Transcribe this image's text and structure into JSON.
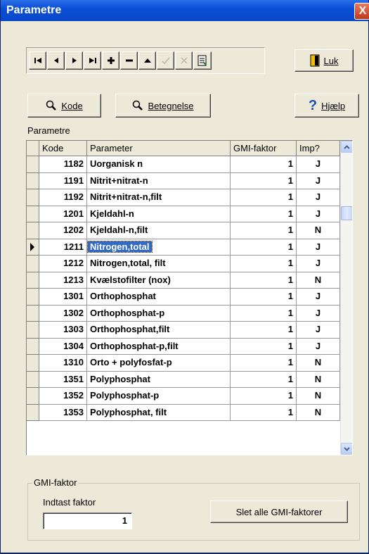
{
  "window": {
    "title": "Parametre",
    "close_glyph": "X"
  },
  "toolbar": {
    "nav_icons": [
      "first-record-icon",
      "prior-record-icon",
      "next-record-icon",
      "last-record-icon",
      "insert-record-icon",
      "delete-record-icon",
      "edit-record-icon",
      "post-record-icon",
      "cancel-record-icon",
      "refresh-record-icon"
    ],
    "luk_label": "Luk",
    "kode_label": "Kode",
    "betegnelse_label": "Betegnelse",
    "hjaelp_label": "Hjælp",
    "help_glyph": "?"
  },
  "grid": {
    "caption": "Parametre",
    "columns": [
      "Kode",
      "Parameter",
      "GMI-faktor",
      "Imp?"
    ],
    "selected_index": 5,
    "rows": [
      {
        "kode": "1182",
        "parameter": "Uorganisk n",
        "gmi": "1",
        "imp": "J"
      },
      {
        "kode": "1191",
        "parameter": "Nitrit+nitrat-n",
        "gmi": "1",
        "imp": "J"
      },
      {
        "kode": "1192",
        "parameter": "Nitrit+nitrat-n,filt",
        "gmi": "1",
        "imp": "J"
      },
      {
        "kode": "1201",
        "parameter": "Kjeldahl-n",
        "gmi": "1",
        "imp": "J"
      },
      {
        "kode": "1202",
        "parameter": "Kjeldahl-n,filt",
        "gmi": "1",
        "imp": "N"
      },
      {
        "kode": "1211",
        "parameter": "Nitrogen,total",
        "gmi": "1",
        "imp": "J"
      },
      {
        "kode": "1212",
        "parameter": "Nitrogen,total, filt",
        "gmi": "1",
        "imp": "J"
      },
      {
        "kode": "1213",
        "parameter": "Kvælstofilter (nox)",
        "gmi": "1",
        "imp": "N"
      },
      {
        "kode": "1301",
        "parameter": "Orthophosphat",
        "gmi": "1",
        "imp": "J"
      },
      {
        "kode": "1302",
        "parameter": "Orthophosphat-p",
        "gmi": "1",
        "imp": "J"
      },
      {
        "kode": "1303",
        "parameter": "Orthophosphat,filt",
        "gmi": "1",
        "imp": "J"
      },
      {
        "kode": "1304",
        "parameter": "Orthophosphat-p,filt",
        "gmi": "1",
        "imp": "J"
      },
      {
        "kode": "1310",
        "parameter": "Orto + polyfosfat-p",
        "gmi": "1",
        "imp": "N"
      },
      {
        "kode": "1351",
        "parameter": "Polyphosphat",
        "gmi": "1",
        "imp": "N"
      },
      {
        "kode": "1352",
        "parameter": "Polyphosphat-p",
        "gmi": "1",
        "imp": "N"
      },
      {
        "kode": "1353",
        "parameter": "Polyphosphat, filt",
        "gmi": "1",
        "imp": "N"
      }
    ]
  },
  "gmi_group": {
    "legend": "GMI-faktor",
    "input_label": "Indtast faktor",
    "input_value": "1",
    "delete_all_label": "Slet alle GMI-faktorer"
  },
  "colors": {
    "title_bar": "#0a47c9",
    "selection": "#316ac5",
    "face": "#ece9d8"
  }
}
